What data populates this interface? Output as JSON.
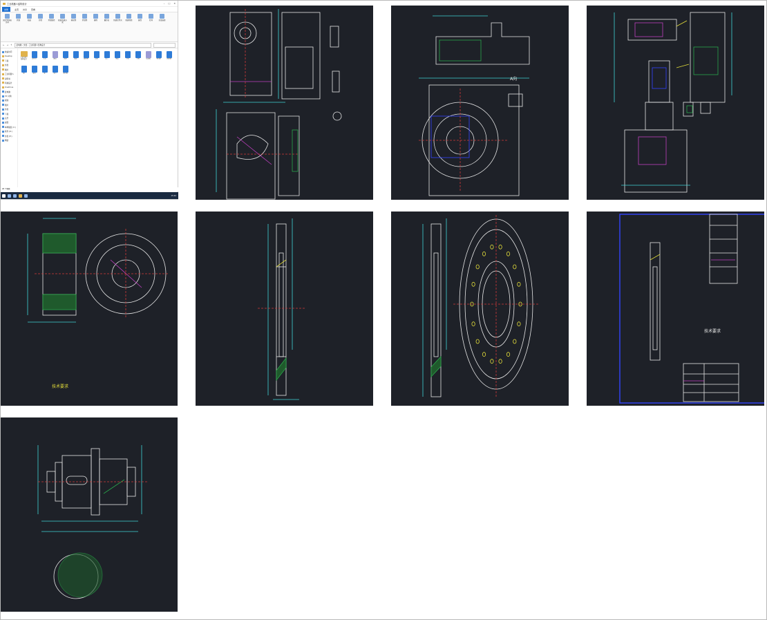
{
  "explorer": {
    "window_title": "工业机器人结构设计",
    "ribbon_tabs": [
      "文件",
      "主页",
      "共享",
      "查看"
    ],
    "ribbon_groups": [
      "固定到快速访问",
      "复制",
      "粘贴",
      "剪切",
      "复制路径",
      "粘贴快捷方式",
      "移动到",
      "复制到",
      "删除",
      "重命名",
      "新建文件夹",
      "新建项目",
      "属性",
      "打开",
      "全部选择"
    ],
    "address_path": "此电脑 › 文档 › 工业机器人结构设计",
    "nav_items": [
      "快速访问",
      "Desktop",
      "下载",
      "文档",
      "图片",
      "工业机器人",
      "说明书",
      "机械设计",
      "OneDrive",
      "此电脑",
      "3D 对象",
      "视频",
      "图片",
      "文档",
      "下载",
      "音乐",
      "桌面",
      "本地磁盘 (C:)",
      "软件 (D:)",
      "文档 (E:)",
      "网络"
    ],
    "files": [
      {
        "name": "工业机器人结构设计",
        "kind": "folder"
      },
      {
        "name": "说明书",
        "kind": "doc"
      },
      {
        "name": "大臂",
        "kind": "doc"
      },
      {
        "name": "图纸",
        "kind": "img"
      },
      {
        "name": "底座",
        "kind": "doc"
      },
      {
        "name": "腰部",
        "kind": "doc"
      },
      {
        "name": "轴承座",
        "kind": "doc"
      },
      {
        "name": "齿轮",
        "kind": "doc"
      },
      {
        "name": "法兰",
        "kind": "doc"
      },
      {
        "name": "端盖",
        "kind": "doc"
      },
      {
        "name": "小臂",
        "kind": "doc"
      },
      {
        "name": "手腕",
        "kind": "doc"
      },
      {
        "name": "总装图",
        "kind": "img"
      },
      {
        "name": "电机座",
        "kind": "doc"
      },
      {
        "name": "减速器",
        "kind": "doc"
      },
      {
        "name": "轴",
        "kind": "doc"
      },
      {
        "name": "套筒",
        "kind": "doc"
      },
      {
        "name": "键",
        "kind": "doc"
      },
      {
        "name": "垫片",
        "kind": "doc"
      },
      {
        "name": "零件图",
        "kind": "doc"
      }
    ],
    "status_text": "20 个项目",
    "clock": "15:42"
  },
  "drawings": [
    {
      "id": "housing",
      "title": ""
    },
    {
      "id": "flange",
      "title": "A向"
    },
    {
      "id": "assembly",
      "title": ""
    },
    {
      "id": "gear",
      "title": "技术要求"
    },
    {
      "id": "shaft_section",
      "title": ""
    },
    {
      "id": "ring",
      "title": ""
    },
    {
      "id": "titled",
      "title": "技术要求"
    },
    {
      "id": "stepped_shaft",
      "title": ""
    }
  ],
  "colors": {
    "cad_bg": "#1e2128",
    "cad_white": "#e8e8e8",
    "cad_cyan": "#3fd6d6",
    "cad_yellow": "#e3dd3a",
    "cad_green": "#2aa84a",
    "cad_red": "#d23a3a",
    "cad_magenta": "#c040c0",
    "cad_blue": "#3344ff"
  }
}
